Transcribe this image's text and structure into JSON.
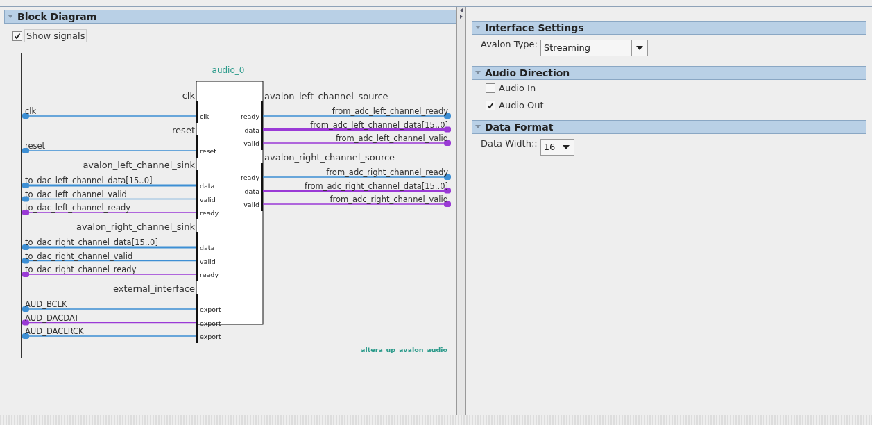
{
  "block_diagram": {
    "title": "Block Diagram",
    "show_signals": {
      "label": "Show signals",
      "checked": true
    },
    "diagram": {
      "instance": "audio_0",
      "module": "altera_up_avalon_audio",
      "inputs": [
        {
          "name": "clk",
          "ports": [
            {
              "signal": "clk",
              "port": "clk",
              "color": "#3d8fd4",
              "bus": false
            }
          ]
        },
        {
          "name": "reset",
          "ports": [
            {
              "signal": "reset",
              "port": "reset",
              "color": "#3d8fd4",
              "bus": false
            }
          ]
        },
        {
          "name": "avalon_left_channel_sink",
          "ports": [
            {
              "signal": "to_dac_left_channel_data[15..0]",
              "port": "data",
              "color": "#3d8fd4",
              "bus": true
            },
            {
              "signal": "to_dac_left_channel_valid",
              "port": "valid",
              "color": "#3d8fd4",
              "bus": false
            },
            {
              "signal": "to_dac_left_channel_ready",
              "port": "ready",
              "color": "#9a3ad6",
              "bus": false
            }
          ]
        },
        {
          "name": "avalon_right_channel_sink",
          "ports": [
            {
              "signal": "to_dac_right_channel_data[15..0]",
              "port": "data",
              "color": "#3d8fd4",
              "bus": true
            },
            {
              "signal": "to_dac_right_channel_valid",
              "port": "valid",
              "color": "#3d8fd4",
              "bus": false
            },
            {
              "signal": "to_dac_right_channel_ready",
              "port": "ready",
              "color": "#9a3ad6",
              "bus": false
            }
          ]
        },
        {
          "name": "external_interface",
          "ports": [
            {
              "signal": "AUD_BCLK",
              "port": "export",
              "color": "#3d8fd4",
              "bus": false
            },
            {
              "signal": "AUD_DACDAT",
              "port": "export",
              "color": "#9a3ad6",
              "bus": false
            },
            {
              "signal": "AUD_DACLRCK",
              "port": "export",
              "color": "#3d8fd4",
              "bus": false
            }
          ]
        }
      ],
      "outputs": [
        {
          "name": "avalon_left_channel_source",
          "ports": [
            {
              "signal": "from_adc_left_channel_ready",
              "port": "ready",
              "color": "#3d8fd4",
              "bus": false
            },
            {
              "signal": "from_adc_left_channel_data[15..0]",
              "port": "data",
              "color": "#9a3ad6",
              "bus": true
            },
            {
              "signal": "from_adc_left_channel_valid",
              "port": "valid",
              "color": "#9a3ad6",
              "bus": false
            }
          ]
        },
        {
          "name": "avalon_right_channel_source",
          "ports": [
            {
              "signal": "from_adc_right_channel_ready",
              "port": "ready",
              "color": "#3d8fd4",
              "bus": false
            },
            {
              "signal": "from_adc_right_channel_data[15..0]",
              "port": "data",
              "color": "#9a3ad6",
              "bus": true
            },
            {
              "signal": "from_adc_right_channel_valid",
              "port": "valid",
              "color": "#9a3ad6",
              "bus": false
            }
          ]
        }
      ]
    }
  },
  "parameters": {
    "sections": [
      {
        "title": "Interface Settings",
        "fields": [
          {
            "kind": "dropdown",
            "label": "Avalon Type:",
            "value": "Streaming"
          }
        ]
      },
      {
        "title": "Audio Direction",
        "fields": [
          {
            "kind": "checkbox",
            "label": "Audio In",
            "checked": false
          },
          {
            "kind": "checkbox",
            "label": "Audio Out",
            "checked": true
          }
        ]
      },
      {
        "title": "Data Format",
        "fields": [
          {
            "kind": "dropdown",
            "label": "Data Width::",
            "value": "16"
          }
        ]
      }
    ]
  }
}
